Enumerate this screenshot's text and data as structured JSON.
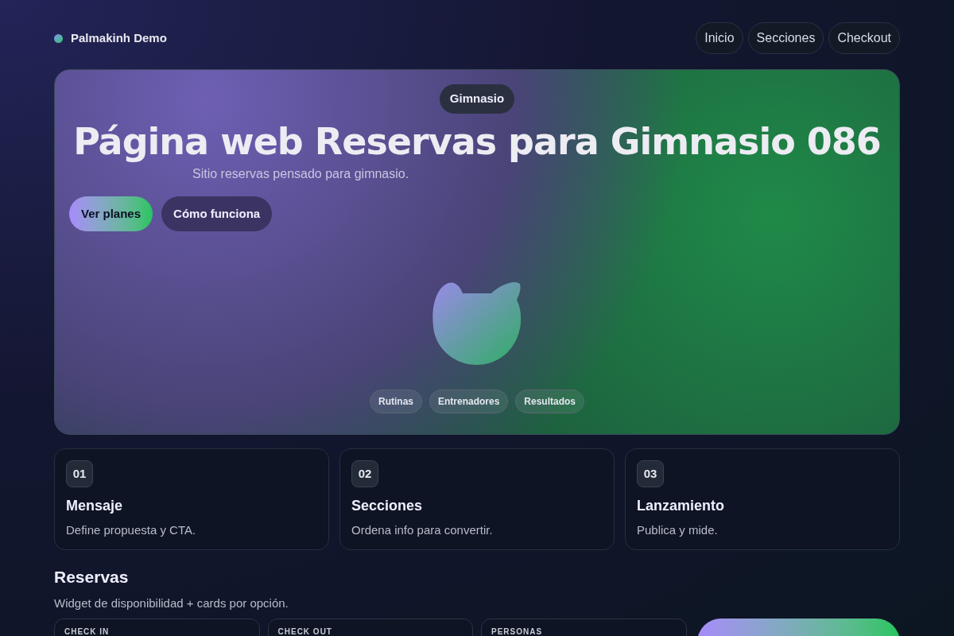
{
  "brand": {
    "name": "Palmakinh Demo"
  },
  "nav": [
    {
      "label": "Inicio"
    },
    {
      "label": "Secciones"
    },
    {
      "label": "Checkout"
    }
  ],
  "hero": {
    "badge": "Gimnasio",
    "title": "Página web Reservas para Gimnasio 086",
    "subtitle": "Sitio reservas pensado para gimnasio.",
    "buttons": [
      {
        "label": "Ver planes",
        "kind": "primary"
      },
      {
        "label": "Cómo funciona",
        "kind": "secondary"
      }
    ],
    "chips": [
      {
        "label": "Rutinas"
      },
      {
        "label": "Entrenadores"
      },
      {
        "label": "Resultados"
      }
    ]
  },
  "steps": [
    {
      "number": "01",
      "title": "Mensaje",
      "text": "Define propuesta y CTA."
    },
    {
      "number": "02",
      "title": "Secciones",
      "text": "Ordena info para convertir."
    },
    {
      "number": "03",
      "title": "Lanzamiento",
      "text": "Publica y mide."
    }
  ],
  "reservas": {
    "title": "Reservas",
    "subtitle": "Widget de disponibilidad + cards por opción.",
    "fields": [
      {
        "label": "CHECK IN"
      },
      {
        "label": "CHECK OUT"
      },
      {
        "label": "PERSONAS"
      }
    ]
  }
}
